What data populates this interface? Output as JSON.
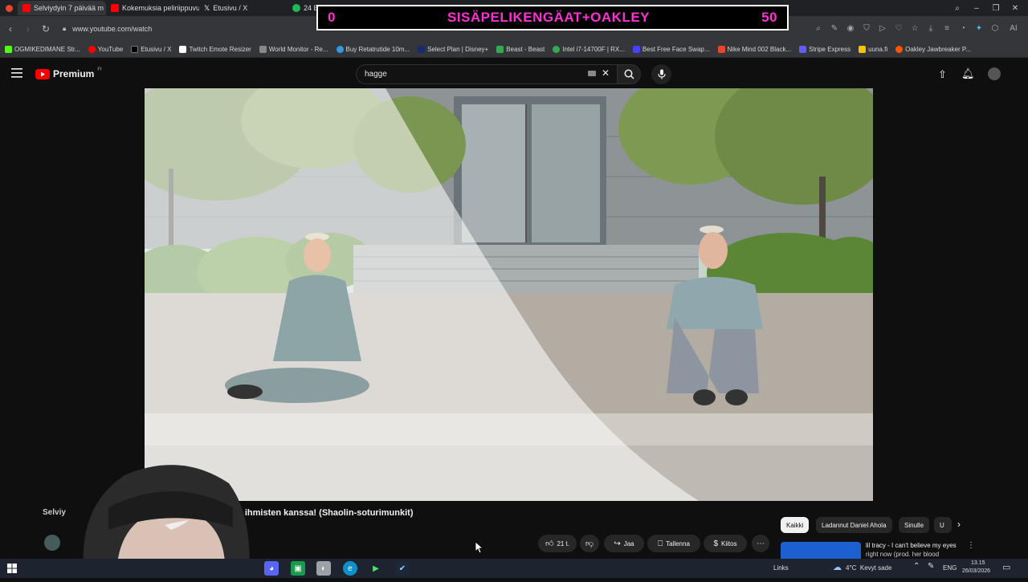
{
  "browser": {
    "tabs": [
      {
        "label": "Selviydyin 7 päivää m",
        "active": true,
        "color": "#ff0000"
      },
      {
        "label": "Kokemuksia peliriippuvu",
        "active": false,
        "color": "#ff0000"
      },
      {
        "label": "Etusivu / X",
        "active": false,
        "color": "#000000"
      },
      {
        "label": "24 Ennakkoa ja yhtachar",
        "active": false,
        "color": "#1db954"
      }
    ],
    "new_tab_label": "+",
    "url": "www.youtube.com/watch",
    "bookmarks": [
      {
        "label": "OGMIKEDIMANE Str...",
        "color": "#53fc18"
      },
      {
        "label": "YouTube",
        "color": "#ff0000"
      },
      {
        "label": "Etusivu / X",
        "color": "#000000"
      },
      {
        "label": "Twitch Emote Resizer",
        "color": "#ffffff"
      },
      {
        "label": "World Monitor - Re...",
        "color": "#888888"
      },
      {
        "label": "Buy Retatrutide 10m...",
        "color": "#2f9be0"
      },
      {
        "label": "Select Plan | Disney+",
        "color": "#1b2a6b"
      },
      {
        "label": "Beast - Beast",
        "color": "#34a853"
      },
      {
        "label": "Intel i7-14700F | RX...",
        "color": "#34a853"
      },
      {
        "label": "Best Free Face Swap...",
        "color": "#4444ff"
      },
      {
        "label": "Nike Mind 002 Black...",
        "color": "#e8452c"
      },
      {
        "label": "Stripe Express",
        "color": "#635bff"
      },
      {
        "label": "uuna.fi",
        "color": "#f5c400"
      },
      {
        "label": "Oakley Jawbreaker P...",
        "color": "#ff5500"
      }
    ]
  },
  "overlay": {
    "left_value": "0",
    "title": "SISÄPELIKENGÄAT+OAKLEY",
    "right_value": "50"
  },
  "youtube": {
    "logo_label": "Premium",
    "logo_sup": "FI",
    "search_value": "hagge",
    "video_title": "...pien ihmisten kanssa! (Shaolin-soturimunkit)",
    "channel_name_partial": "Selviy",
    "actions": {
      "like_count": "21 t.",
      "share": "Jaa",
      "save": "Tallenna",
      "thanks": "Kiitos"
    },
    "chips": [
      "Kaikki",
      "Ladannut Daniel Ahola",
      "Sinulle",
      "U"
    ],
    "recommendation_title": "lil tracy - I can't believe my eyes",
    "recommendation_sub": "right now (prod. her blood"
  },
  "taskbar": {
    "links_label": "Links",
    "weather": "4°C  Kevyt sade",
    "language": "ENG",
    "time": "13.15",
    "date": "26/03/2026"
  },
  "colors": {
    "accent_red": "#ff0000",
    "overlay_pink": "#ff2fd4"
  }
}
